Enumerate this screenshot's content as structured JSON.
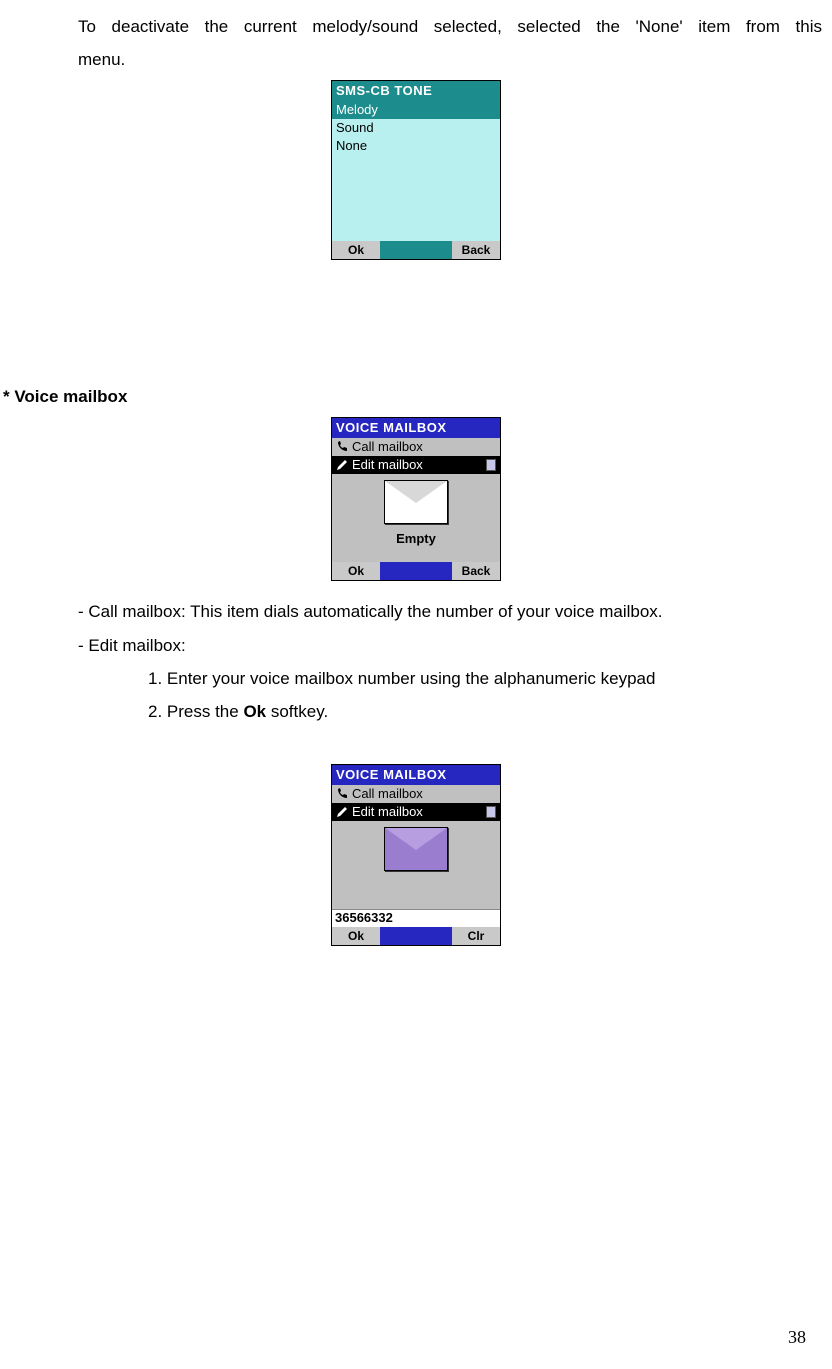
{
  "para1": "To deactivate the current melody/sound selected, selected the 'None' item from this menu.",
  "shot1": {
    "title": "SMS-CB TONE",
    "items": [
      "Melody",
      "Sound",
      "None"
    ],
    "ok": "Ok",
    "back": "Back"
  },
  "section": "* Voice mailbox",
  "shot2": {
    "title": "VOICE MAILBOX",
    "item1": "Call mailbox",
    "item2": "Edit mailbox",
    "label": "Empty",
    "ok": "Ok",
    "back": "Back"
  },
  "desc1": "- Call mailbox: This item dials automatically the number of your voice mailbox.",
  "desc2": "- Edit mailbox:",
  "step1": "1. Enter your voice mailbox number using the alphanumeric keypad",
  "step2_a": "2. Press the ",
  "step2_b": "Ok",
  "step2_c": " softkey.",
  "shot3": {
    "title": "VOICE MAILBOX",
    "item1": "Call mailbox",
    "item2": "Edit mailbox",
    "input": "36566332",
    "ok": "Ok",
    "clr": "Clr"
  },
  "page_num": "38"
}
